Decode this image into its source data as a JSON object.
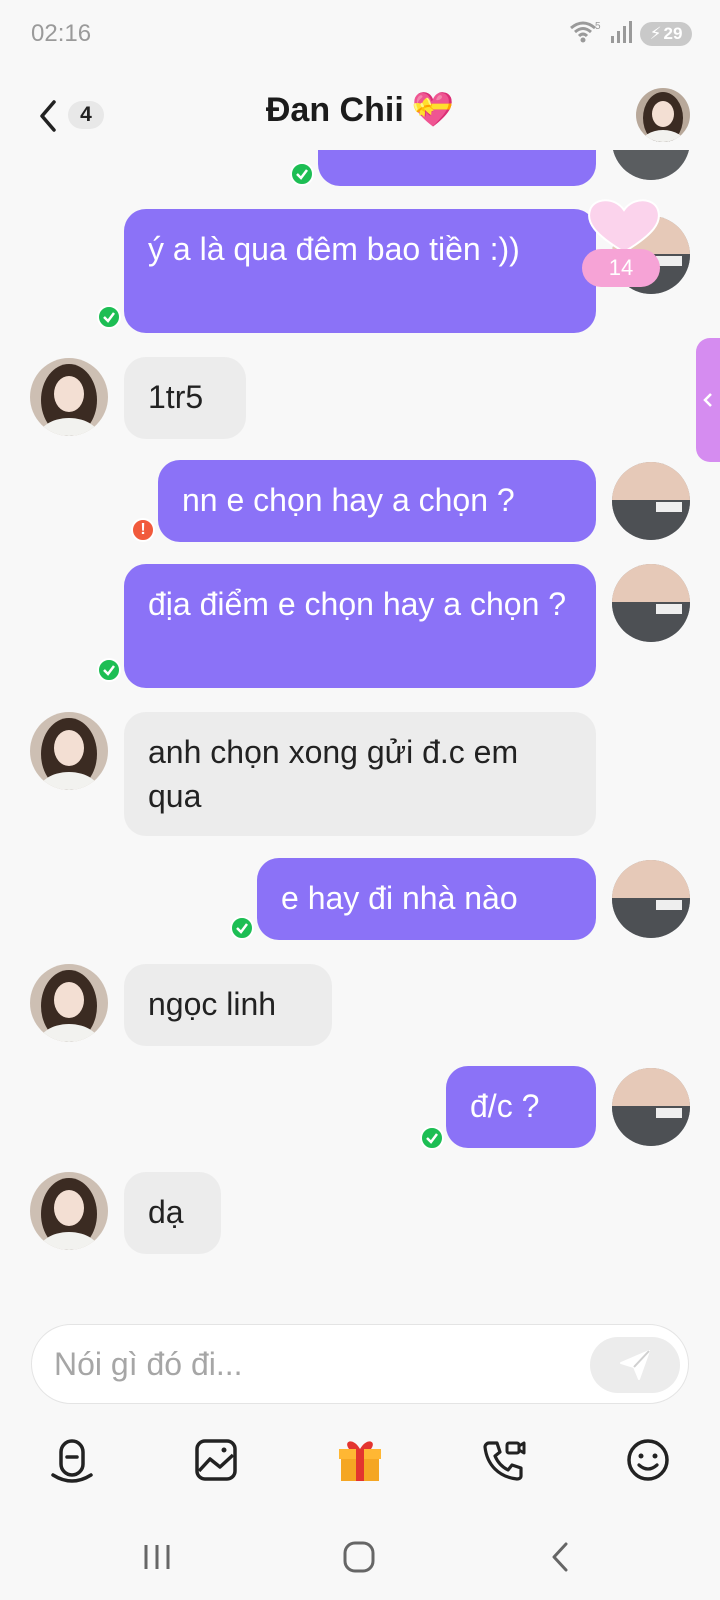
{
  "status_bar": {
    "time": "02:16",
    "wifi_label": "5",
    "battery": "29"
  },
  "header": {
    "unread_count": "4",
    "title": "Đan Chii",
    "title_emoji": "💝"
  },
  "reaction": {
    "count": "14"
  },
  "messages": [
    {
      "dir": "out",
      "text": "ý a là qua đêm bao tiền :))",
      "status": "sent"
    },
    {
      "dir": "in",
      "text": "1tr5"
    },
    {
      "dir": "out",
      "text": "nn e chọn hay a chọn ?",
      "status": "error"
    },
    {
      "dir": "out",
      "text": "địa điểm e chọn hay a chọn ?",
      "status": "sent"
    },
    {
      "dir": "in",
      "text": "anh chọn xong gửi đ.c em qua"
    },
    {
      "dir": "out",
      "text": "e hay đi nhà nào",
      "status": "sent"
    },
    {
      "dir": "in",
      "text": "ngọc linh"
    },
    {
      "dir": "out",
      "text": "đ/c ?",
      "status": "sent"
    },
    {
      "dir": "in",
      "text": "dạ"
    }
  ],
  "composer": {
    "placeholder": "Nói gì đó đi..."
  },
  "colors": {
    "outgoing": "#8b72f7",
    "incoming": "#ececec",
    "sent_tick": "#1dbe54",
    "error": "#f15a3c"
  }
}
